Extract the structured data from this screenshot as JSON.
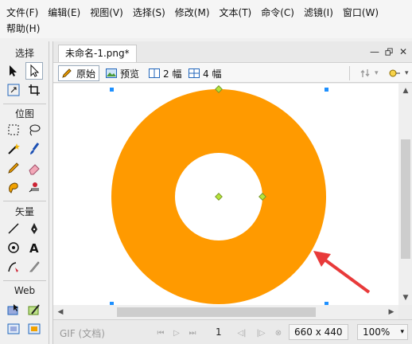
{
  "menu": {
    "row1": [
      "文件(F)",
      "编辑(E)",
      "视图(V)",
      "选择(S)",
      "修改(M)",
      "文本(T)",
      "命令(C)",
      "滤镜(I)",
      "窗口(W)"
    ],
    "row2": [
      "帮助(H)"
    ]
  },
  "tools": {
    "select_title": "选择",
    "bitmap_title": "位图",
    "vector_title": "矢量",
    "web_title": "Web",
    "icons": {
      "pointer": "pointer-icon",
      "subselect": "subselection-icon",
      "scale": "scale-icon",
      "crop": "crop-icon",
      "marquee": "marquee-icon",
      "lasso": "lasso-icon",
      "magic_wand": "magic-wand-icon",
      "brush": "brush-icon",
      "pencil": "pencil-icon",
      "eraser": "eraser-icon",
      "blur": "blur-icon",
      "rubber_stamp": "rubber-stamp-icon",
      "line": "line-icon",
      "pen": "pen-icon",
      "ellipse": "ellipse-icon",
      "text": "text-icon",
      "freeform": "freeform-icon",
      "knife": "knife-icon",
      "hotspot": "hotspot-icon",
      "slice": "slice-icon",
      "hide_slices": "hide-slices-icon",
      "show_slices": "show-slices-icon"
    }
  },
  "document": {
    "tab_title": "未命名-1.png*",
    "view_tabs": {
      "original": "原始",
      "preview": "预览",
      "two_up": "2 幅",
      "four_up": "4 幅"
    },
    "canvas": {
      "shape": "donut",
      "fill_color": "#FF9A00",
      "background": "#FFFFFF"
    },
    "status": {
      "format": "GIF (文档)",
      "frame": "1",
      "dimensions": "660 x 440",
      "zoom": "100%"
    }
  },
  "colors": {
    "accent_handle": "#1E90FF",
    "center_handle": "#B6E33A",
    "annotation_arrow": "#E83A3A"
  }
}
